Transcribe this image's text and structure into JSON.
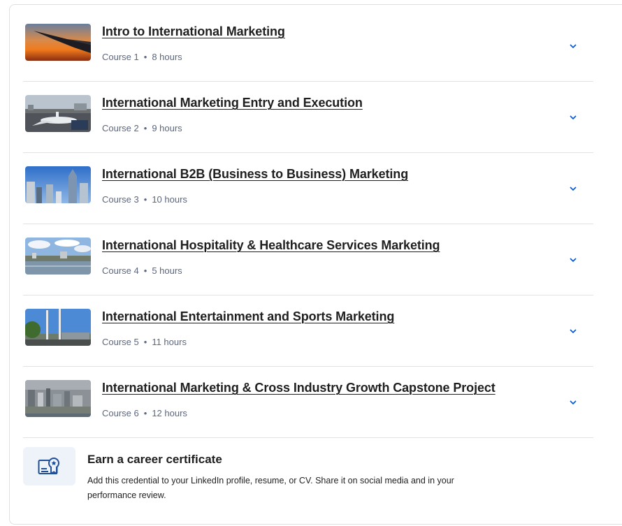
{
  "courses": [
    {
      "title": "Intro to International Marketing",
      "course": "Course 1",
      "duration": "8 hours",
      "thumb": "airplane-wing-sunset-image"
    },
    {
      "title": "International Marketing Entry and Execution",
      "course": "Course 2",
      "duration": "9 hours",
      "thumb": "airport-plane-image"
    },
    {
      "title": "International B2B (Business to Business) Marketing",
      "course": "Course 3",
      "duration": "10 hours",
      "thumb": "skyscrapers-image"
    },
    {
      "title": "International Hospitality & Healthcare Services Marketing",
      "course": "Course 4",
      "duration": "5 hours",
      "thumb": "waterfront-city-image"
    },
    {
      "title": "International Entertainment and Sports Marketing",
      "course": "Course 5",
      "duration": "11 hours",
      "thumb": "flagpoles-plaza-image"
    },
    {
      "title": "International Marketing & Cross Industry Growth Capstone Project",
      "course": "Course 6",
      "duration": "12 hours",
      "thumb": "city-aerial-image"
    }
  ],
  "separator": "•",
  "certificate": {
    "title": "Earn a career certificate",
    "description": "Add this credential to your LinkedIn profile, resume, or CV. Share it on social media and in your performance review.",
    "icon": "certificate-icon"
  },
  "colors": {
    "text": "#1f1f1f",
    "meta": "#5b6780",
    "chevron": "#0056d2",
    "cert_bg": "#eef3fa",
    "divider": "#e2e2e2"
  }
}
